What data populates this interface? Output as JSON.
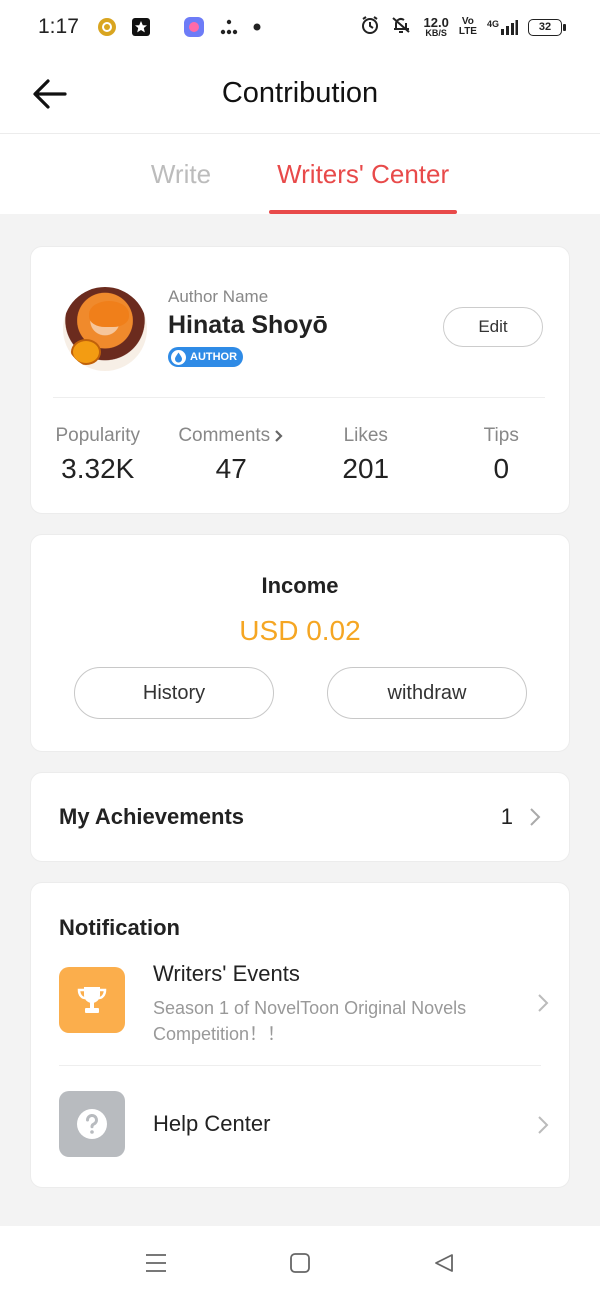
{
  "status_bar": {
    "time": "1:17",
    "speed_value": "12.0",
    "speed_unit": "KB/S",
    "volte_top": "Vo",
    "volte_bottom": "LTE",
    "network": "4G",
    "battery": "32"
  },
  "header": {
    "title": "Contribution"
  },
  "tabs": [
    {
      "label": "Write",
      "active": false
    },
    {
      "label": "Writers' Center",
      "active": true
    }
  ],
  "profile": {
    "author_label": "Author Name",
    "name": "Hinata Shoyō",
    "badge": "AUTHOR",
    "edit_label": "Edit",
    "stats": [
      {
        "label": "Popularity",
        "value": "3.32K"
      },
      {
        "label": "Comments",
        "value": "47"
      },
      {
        "label": "Likes",
        "value": "201"
      },
      {
        "label": "Tips",
        "value": "0"
      }
    ]
  },
  "income": {
    "title": "Income",
    "value": "USD 0.02",
    "history_label": "History",
    "withdraw_label": "withdraw"
  },
  "achievements": {
    "label": "My Achievements",
    "count": "1"
  },
  "notification": {
    "title": "Notification",
    "items": [
      {
        "title": "Writers' Events",
        "subtitle": "Season 1 of NovelToon Original Novels Competition！！",
        "icon": "trophy-icon",
        "icon_color": "#fbae4c"
      },
      {
        "title": "Help Center",
        "icon": "question-icon",
        "icon_color": "#b8bbbf"
      }
    ]
  },
  "colors": {
    "accent_red": "#e84a4a",
    "income_orange": "#f5a623",
    "badge_blue": "#2f8be6"
  }
}
